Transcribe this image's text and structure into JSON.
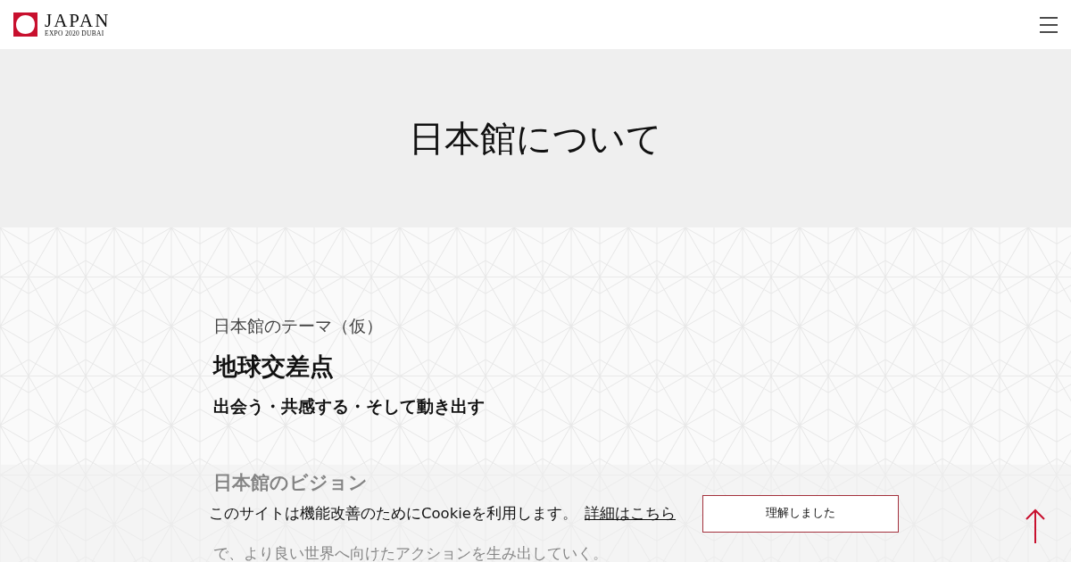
{
  "header": {
    "logo_title": "JAPAN",
    "logo_subtitle": "EXPO 2020 DUBAI"
  },
  "hero": {
    "title": "日本館について"
  },
  "theme": {
    "label": "日本館のテーマ（仮）",
    "title": "地球交差点",
    "subtitle": "出会う・共感する・そして動き出す"
  },
  "vision": {
    "heading": "日本館のビジョン",
    "text_line": "で、より良い世界へ向けたアクションを生み出していく。"
  },
  "cookie_banner": {
    "message": "このサイトは機能改善のためにCookieを利用します。",
    "link": "詳細はこちら",
    "button": "理解しました"
  }
}
